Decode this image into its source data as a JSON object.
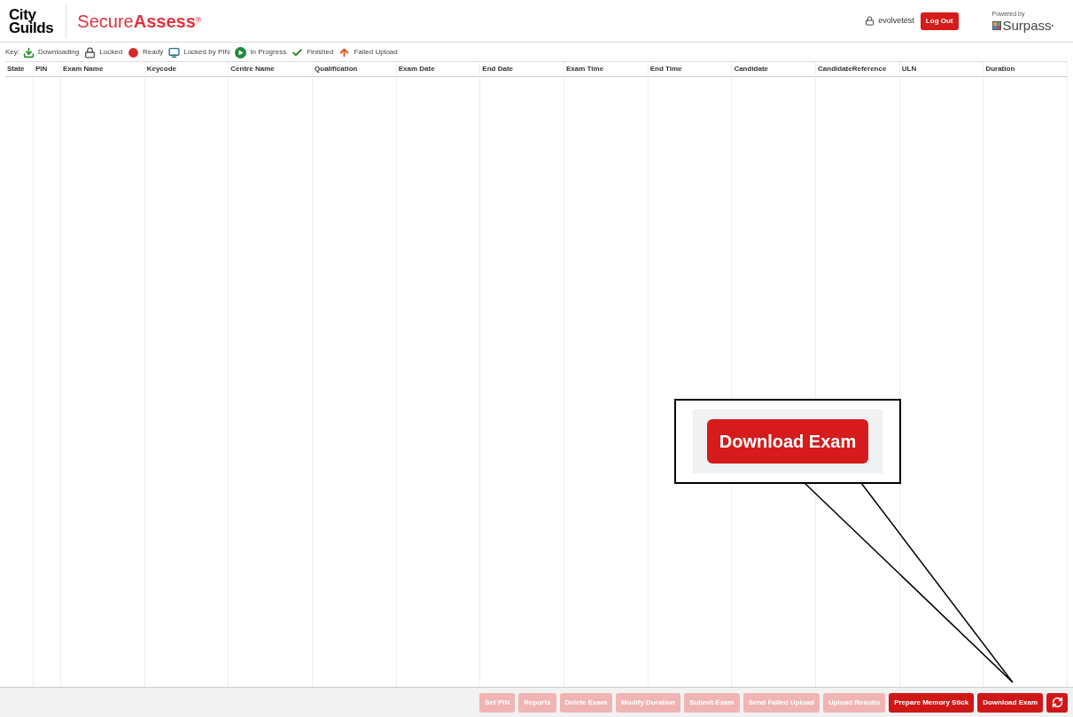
{
  "header": {
    "logo_line1": "City",
    "logo_line2": "Guilds",
    "product_light": "Secure",
    "product_bold": "Assess",
    "registered": "®",
    "user": "evolvetest",
    "logout": "Log Out",
    "powered_by": "Powered by",
    "surpass": "Surpass",
    "surpass_mark": "•"
  },
  "key": {
    "label": "Key:",
    "items": [
      {
        "kind": "downloading",
        "label": "Downloading"
      },
      {
        "kind": "locked",
        "label": "Locked"
      },
      {
        "kind": "ready",
        "label": "Ready"
      },
      {
        "kind": "locked_pin",
        "label": "Locked by PIN"
      },
      {
        "kind": "in_progress",
        "label": "In Progress"
      },
      {
        "kind": "finished",
        "label": "Finished"
      },
      {
        "kind": "failed_upload",
        "label": "Failed Upload"
      }
    ]
  },
  "table": {
    "columns": [
      "State",
      "PIN",
      "Exam Name",
      "Keycode",
      "Centre Name",
      "Qualification",
      "Exam Date",
      "End Date",
      "Exam Time",
      "End Time",
      "Candidate",
      "CandidateReference",
      "ULN",
      "Duration"
    ]
  },
  "footer": {
    "buttons": [
      {
        "label": "Set PIN",
        "disabled": true
      },
      {
        "label": "Reports",
        "disabled": true
      },
      {
        "label": "Delete Exam",
        "disabled": true
      },
      {
        "label": "Modify Duration",
        "disabled": true
      },
      {
        "label": "Submit Exam",
        "disabled": true
      },
      {
        "label": "Send Failed Upload",
        "disabled": true
      },
      {
        "label": "Upload Results",
        "disabled": true
      },
      {
        "label": "Prepare Memory Stick",
        "disabled": false
      },
      {
        "label": "Download Exam",
        "disabled": false
      }
    ]
  },
  "callout": {
    "label": "Download Exam"
  }
}
